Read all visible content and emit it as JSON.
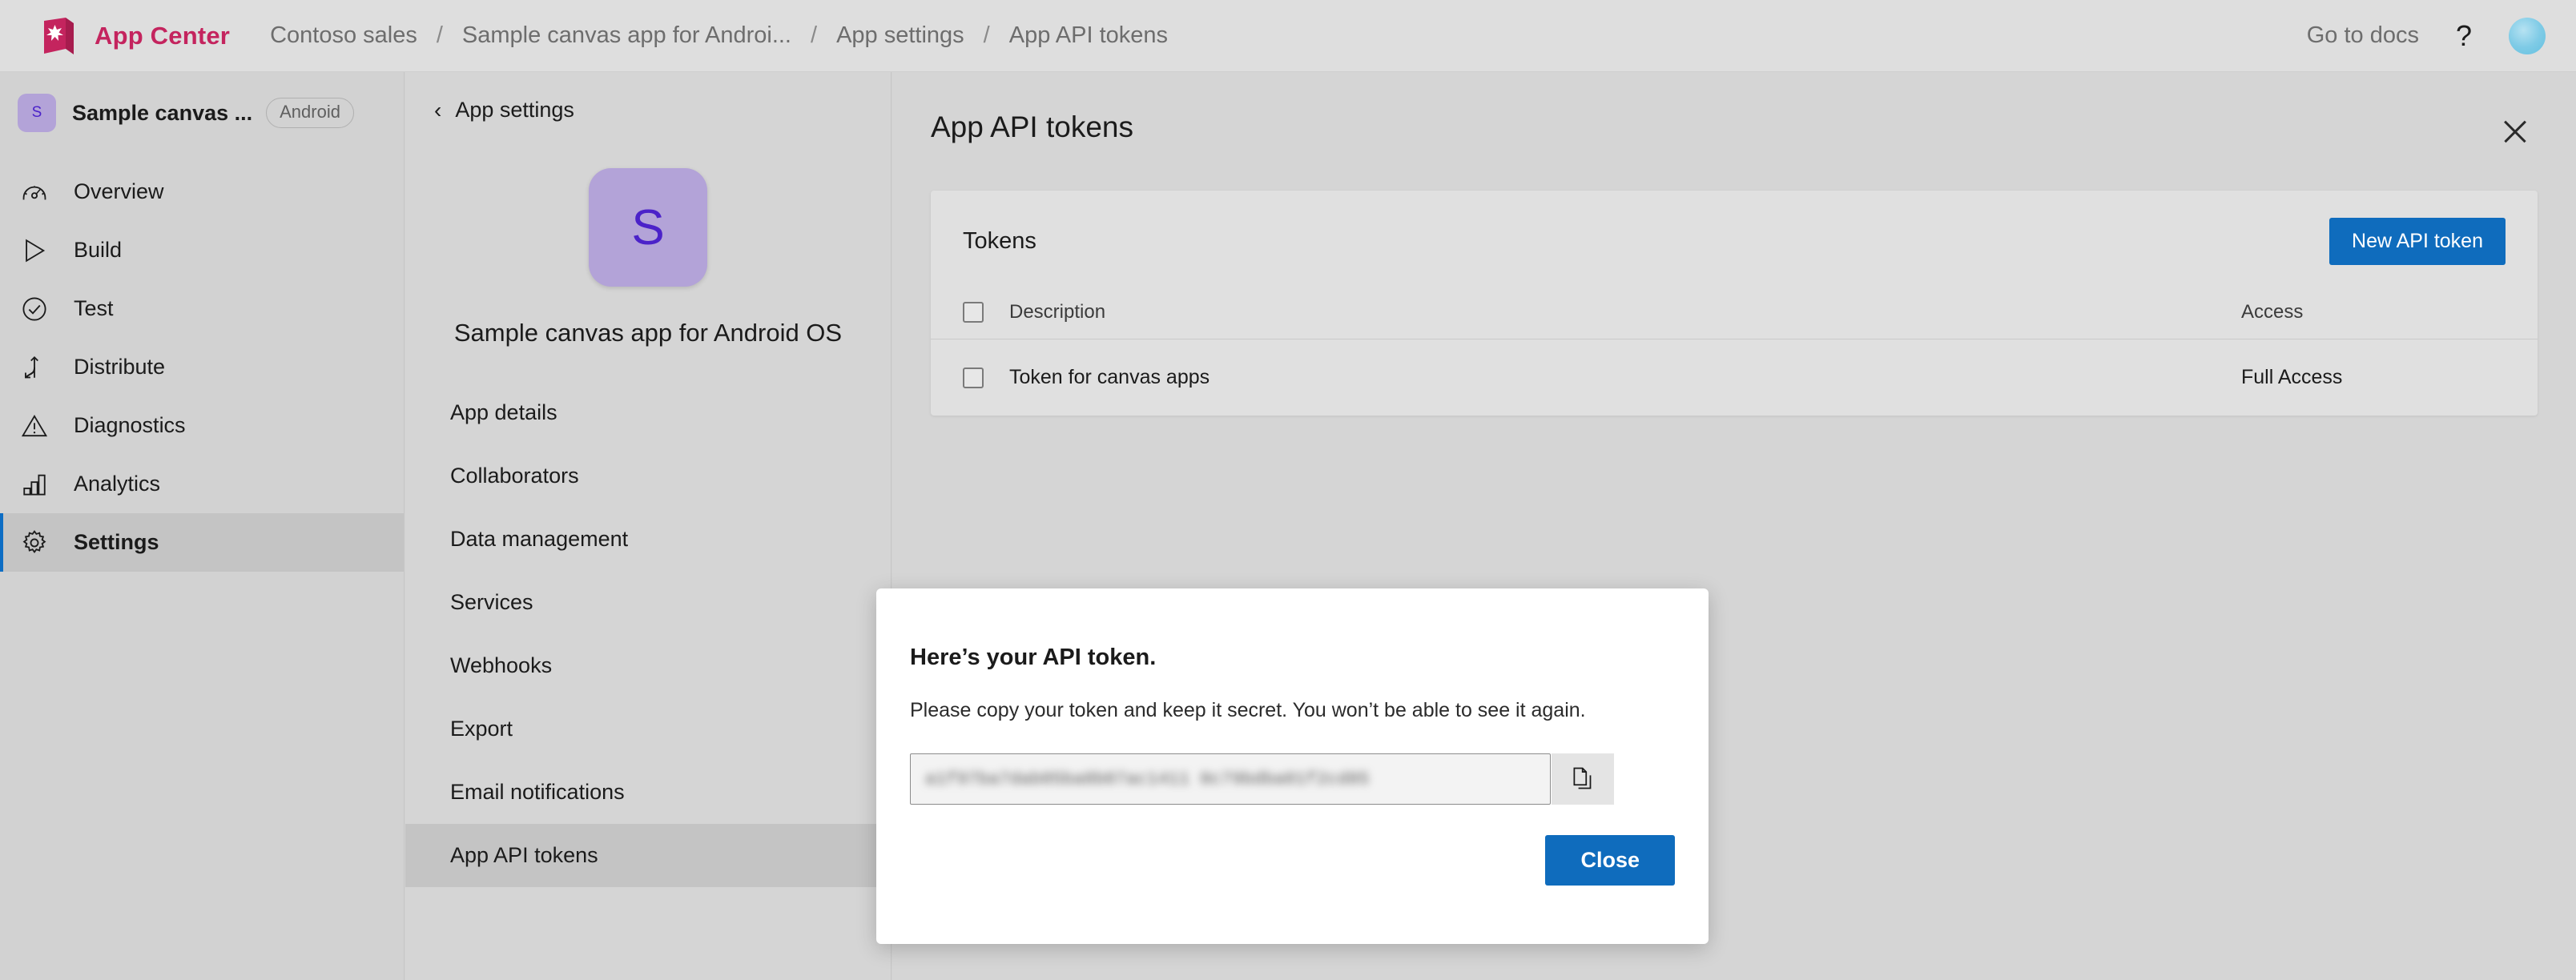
{
  "topbar": {
    "logo_icon": "app-center-logo-icon",
    "brand": "App Center",
    "breadcrumbs": [
      {
        "label": "Contoso sales"
      },
      {
        "label": "Sample canvas app for Androi..."
      },
      {
        "label": "App settings"
      },
      {
        "label": "App API tokens"
      }
    ],
    "separator": "/",
    "go_to_docs": "Go to docs",
    "help_icon": "?",
    "avatar_name": "user-avatar"
  },
  "leftnav": {
    "app_initial": "S",
    "app_title": "Sample canvas ...",
    "platform_pill": "Android",
    "items": [
      {
        "label": "Overview",
        "icon": "gauge-icon",
        "active": false
      },
      {
        "label": "Build",
        "icon": "play-icon",
        "active": false
      },
      {
        "label": "Test",
        "icon": "check-circle-icon",
        "active": false
      },
      {
        "label": "Distribute",
        "icon": "distribute-icon",
        "active": false
      },
      {
        "label": "Diagnostics",
        "icon": "warning-icon",
        "active": false
      },
      {
        "label": "Analytics",
        "icon": "bar-chart-icon",
        "active": false
      },
      {
        "label": "Settings",
        "icon": "gear-icon",
        "active": true
      }
    ]
  },
  "settings_panel": {
    "back_label": "App settings",
    "back_icon": "chevron-left-icon",
    "app_initial": "S",
    "app_full_name": "Sample canvas app for Android OS",
    "items": [
      {
        "label": "App details",
        "active": false
      },
      {
        "label": "Collaborators",
        "active": false
      },
      {
        "label": "Data management",
        "active": false
      },
      {
        "label": "Services",
        "active": false
      },
      {
        "label": "Webhooks",
        "active": false
      },
      {
        "label": "Export",
        "active": false
      },
      {
        "label": "Email notifications",
        "active": false
      },
      {
        "label": "App API tokens",
        "active": true
      }
    ]
  },
  "main": {
    "page_title": "App API tokens",
    "close_icon": "close-icon",
    "card": {
      "title": "Tokens",
      "new_token_button": "New API token",
      "columns": {
        "description": "Description",
        "access": "Access"
      },
      "rows": [
        {
          "description": "Token for canvas apps",
          "access": "Full Access",
          "checked": false
        }
      ]
    }
  },
  "modal": {
    "title": "Here’s your API token.",
    "subtitle": "Please copy your token and keep it secret. You won’t be able to see it again.",
    "token_value": "a1f97ba7dab05ba8b07ac1411 0c79bdba01f2cd85",
    "copy_icon": "copy-icon",
    "close_button": "Close"
  },
  "colors": {
    "brand_magenta": "#c4245e",
    "accent_blue": "#0f6cbd",
    "active_indicator": "#0d6dc4",
    "app_badge_bg": "#b3a3d8",
    "app_badge_fg": "#4b22c9",
    "page_bg": "#d5d5d5",
    "nav_bg": "#d2d2d2",
    "topbar_bg": "#dedede",
    "card_bg": "#e0e0e0"
  }
}
